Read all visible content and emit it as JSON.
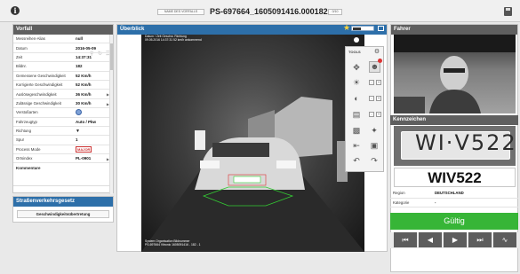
{
  "topbar": {
    "name_label": "NAME DES VORFALLS",
    "case_id": "PS-697664_1605091416.000182",
    "count": "0/10"
  },
  "left_panel": {
    "title": "Vorfall",
    "rows": [
      {
        "label": "Messreihen-Alias",
        "value": "null"
      },
      {
        "label": "Datum",
        "value": "2016-05-09"
      },
      {
        "label": "Zeit",
        "value": "14:37:31"
      },
      {
        "label": "Bildnr.",
        "value": "182"
      },
      {
        "label": "Gemessene Geschwindigkeit",
        "value": "52 Km/h"
      },
      {
        "label": "Korrigierte Geschwindigkeit",
        "value": "52 Km/h"
      },
      {
        "label": "Auslösegeschwindigkeit",
        "value": "36 Km/h"
      },
      {
        "label": "Zulässige Geschwindigkeit",
        "value": "30 Km/h"
      },
      {
        "label": "Verstoßarten",
        "value": ""
      },
      {
        "label": "Fahrzeugtyp",
        "value": "Auto / Pkw"
      },
      {
        "label": "Richtung",
        "value": ""
      },
      {
        "label": "Spur",
        "value": "1"
      },
      {
        "label": "Process Mode",
        "value": "MAJOR"
      },
      {
        "label": "Ortsindex",
        "value": "PL-0901"
      }
    ],
    "comments_label": "Kommentare"
  },
  "law_panel": {
    "title": "Straßenverkehrsgesetz",
    "button_label": "Geschwindigkeitsübertretung"
  },
  "center_panel": {
    "title": "Überblick",
    "overlay_top": [
      "Datum / Zeit      Geschw.   Richtung",
      "09.05.2016 14:37:31  52 km/h   ankommend"
    ],
    "overlay_bottom": [
      "System    Organisation  Bildnummer",
      "PS-697664  Vitronic    1605091416 - 182 - 1"
    ],
    "tools_label": "TOOLS",
    "plate_in_photo": "WIV 522"
  },
  "right_panel": {
    "driver_title": "Fahrer",
    "plate_title": "Kennzeichen",
    "plate_image_text": "WI·V522",
    "plate_value": "WIV522",
    "rows": [
      {
        "label": "Region",
        "value": "DEUTSCHLAND"
      },
      {
        "label": "Kategorie",
        "value": "-"
      }
    ],
    "valid_label": "Gültig"
  },
  "colors": {
    "accent_blue": "#2d6fa9",
    "valid_green": "#37b537",
    "header_grey": "#5f5f5f",
    "major_red": "#cc3333"
  }
}
